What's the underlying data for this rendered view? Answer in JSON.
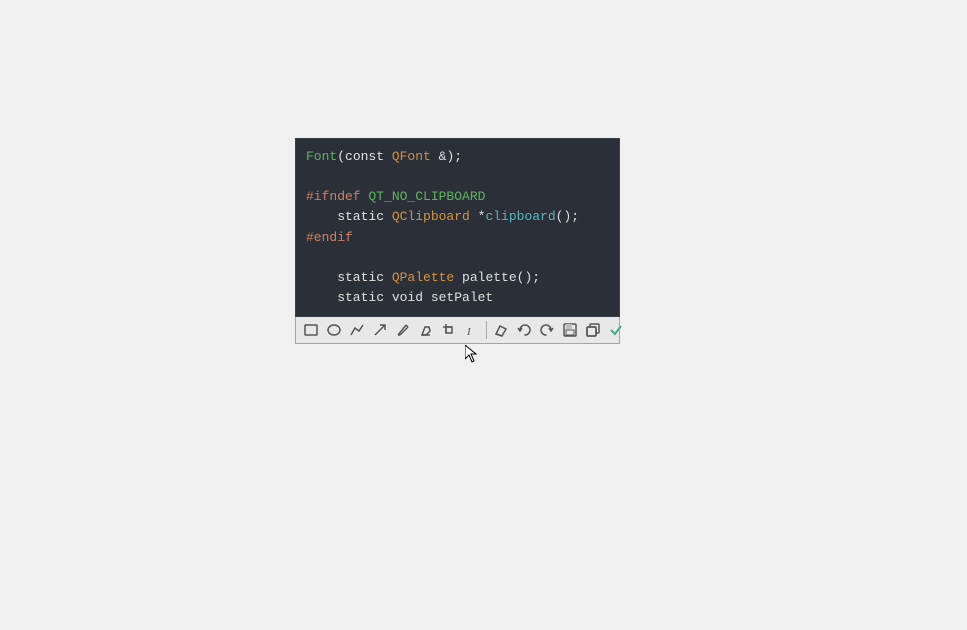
{
  "background": "#f0f0f0",
  "editor": {
    "lines": [
      {
        "parts": [
          {
            "text": "Font",
            "color": "green"
          },
          {
            "text": "(const ",
            "color": "white"
          },
          {
            "text": "QFont",
            "color": "orange"
          },
          {
            "text": " &);",
            "color": "white"
          }
        ]
      },
      {
        "parts": []
      },
      {
        "parts": [
          {
            "text": "#ifndef",
            "color": "directive"
          },
          {
            "text": " QT_NO_CLIPBOARD",
            "color": "green"
          }
        ]
      },
      {
        "parts": [
          {
            "text": "    static ",
            "color": "white"
          },
          {
            "text": "QClipboard",
            "color": "orange"
          },
          {
            "text": " *",
            "color": "white"
          },
          {
            "text": "clipboard",
            "color": "cyan"
          },
          {
            "text": "();",
            "color": "white"
          }
        ]
      },
      {
        "parts": [
          {
            "text": "#endif",
            "color": "directive"
          }
        ]
      },
      {
        "parts": []
      },
      {
        "parts": [
          {
            "text": "    static ",
            "color": "white"
          },
          {
            "text": "QPalette",
            "color": "orange"
          },
          {
            "text": " palette();",
            "color": "white"
          }
        ]
      },
      {
        "parts": [
          {
            "text": "    static void ",
            "color": "white"
          },
          {
            "text": "setPalet",
            "color": "white"
          }
        ]
      }
    ]
  },
  "toolbar": {
    "buttons": [
      {
        "name": "rectangle-tool",
        "icon": "rect",
        "label": "Rectangle"
      },
      {
        "name": "ellipse-tool",
        "icon": "ellipse",
        "label": "Ellipse"
      },
      {
        "name": "line-tool",
        "icon": "line",
        "label": "Line"
      },
      {
        "name": "arrow-tool",
        "icon": "arrow",
        "label": "Arrow"
      },
      {
        "name": "pencil-tool",
        "icon": "pencil",
        "label": "Pencil"
      },
      {
        "name": "highlight-tool",
        "icon": "highlight",
        "label": "Highlight"
      },
      {
        "name": "crop-tool",
        "icon": "crop",
        "label": "Crop"
      },
      {
        "name": "text-tool",
        "icon": "text",
        "label": "Text"
      },
      {
        "name": "eraser-tool",
        "icon": "eraser",
        "label": "Eraser"
      },
      {
        "name": "undo-button",
        "icon": "undo",
        "label": "Undo"
      },
      {
        "name": "redo-button",
        "icon": "redo",
        "label": "Redo"
      },
      {
        "name": "save-button",
        "icon": "save",
        "label": "Save"
      },
      {
        "name": "copy-button",
        "icon": "copy",
        "label": "Copy"
      },
      {
        "name": "confirm-button",
        "icon": "check",
        "label": "Confirm"
      }
    ]
  }
}
